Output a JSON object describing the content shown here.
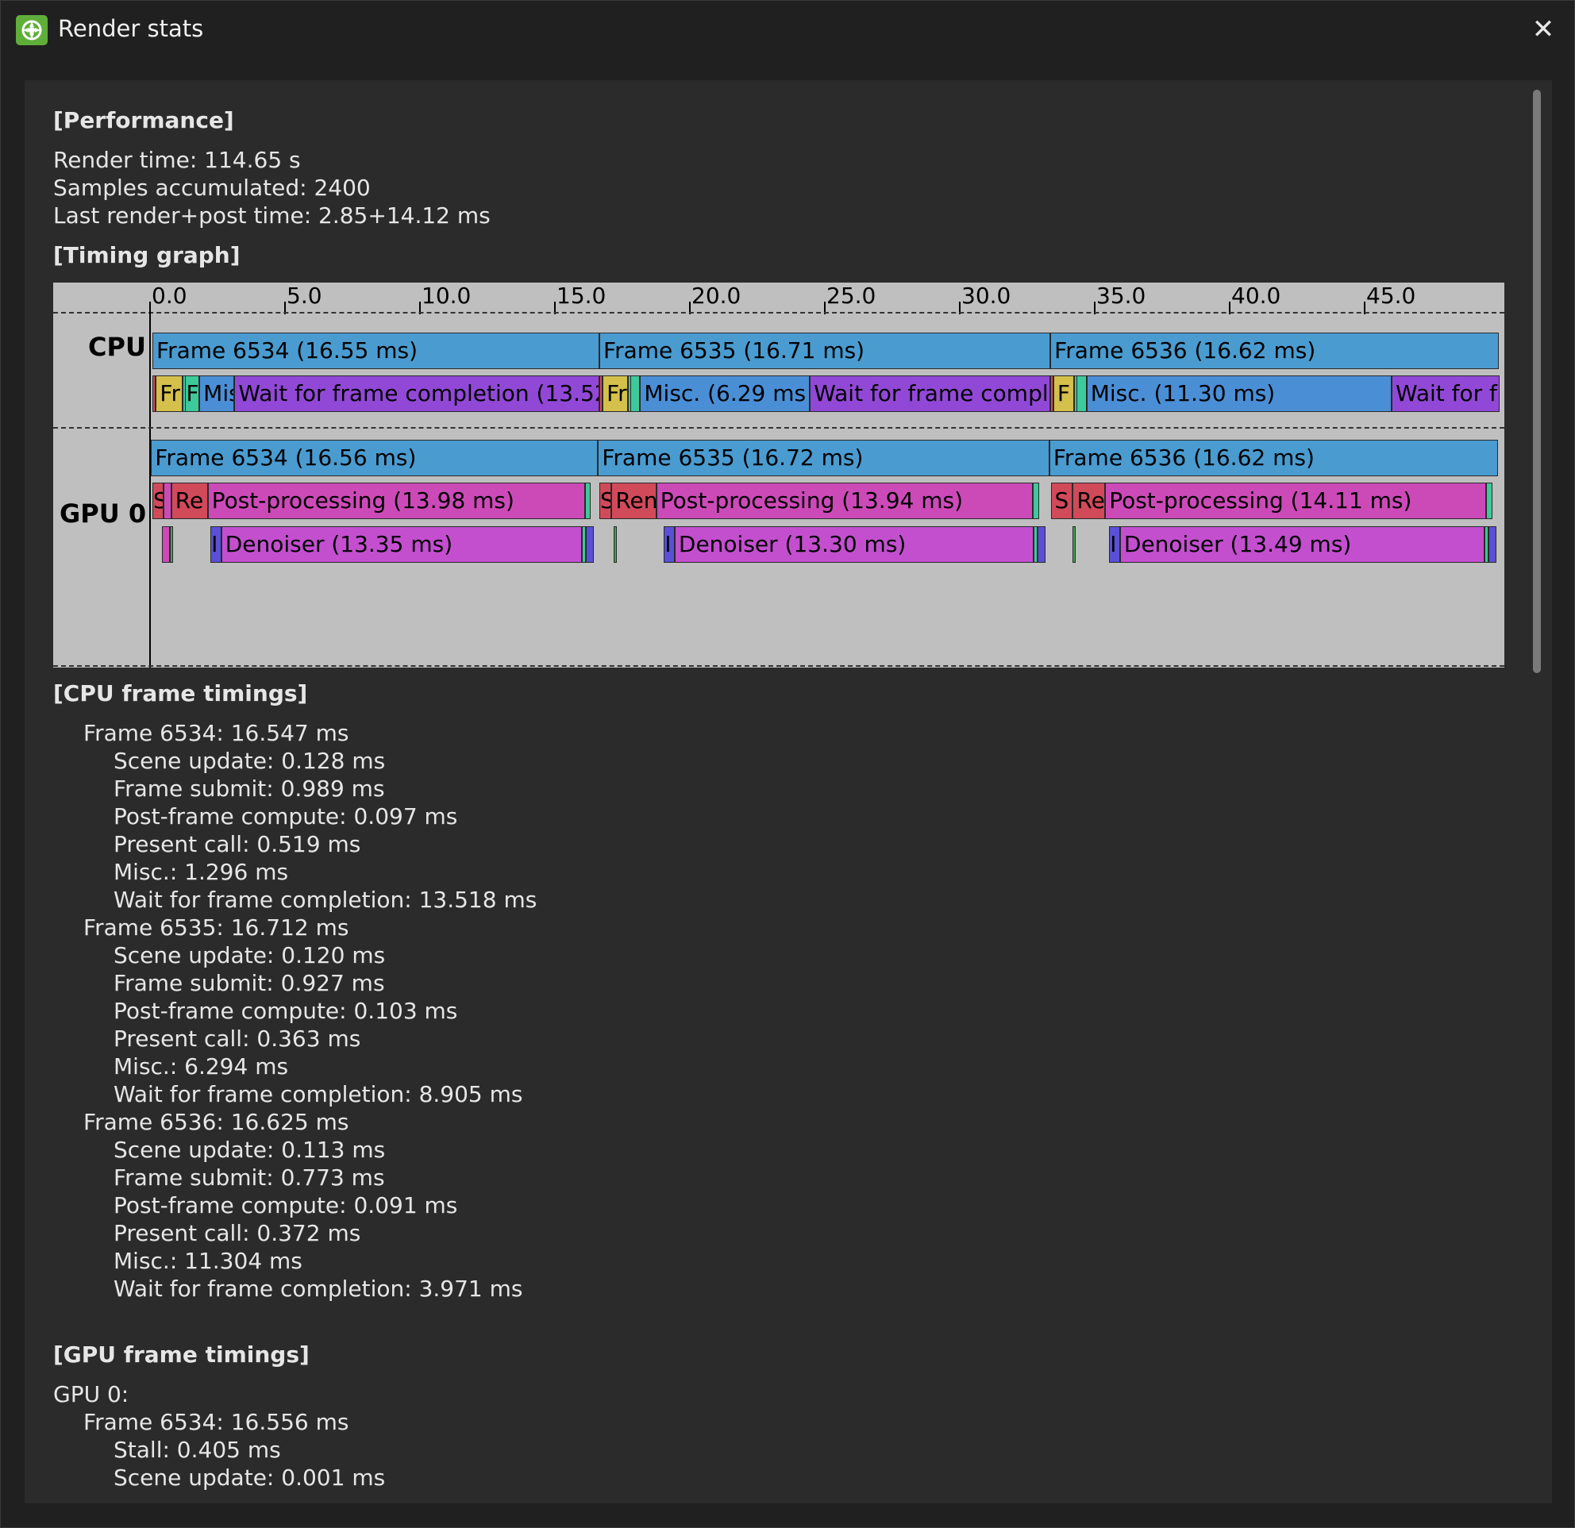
{
  "window": {
    "title": "Render stats",
    "close_glyph": "✕",
    "app_icon": "app-logo-icon"
  },
  "performance": {
    "header": "[Performance]",
    "render_time": "Render time: 114.65 s",
    "samples": "Samples accumulated: 2400",
    "last_time": "Last render+post time: 2.85+14.12 ms"
  },
  "timing_graph": {
    "header": "[Timing graph]",
    "ticks": [
      "0.0",
      "5.0",
      "10.0",
      "15.0",
      "20.0",
      "25.0",
      "30.0",
      "35.0",
      "40.0",
      "45.0"
    ],
    "cpu_label": "CPU",
    "gpu_label": "GPU 0",
    "colors": {
      "frame": "#4a9bd0",
      "yellow": "#d4c04a",
      "teal": "#3ec99a",
      "blue": "#4a8ed6",
      "purple": "#9148d6",
      "red": "#d14a5a",
      "pink": "#cc4ab8",
      "magenta": "#c34fcf",
      "indigo": "#5a4fd6",
      "green": "#3aa84a"
    },
    "cpu_frames": [
      "Frame 6534 (16.55 ms)",
      "Frame 6535 (16.71 ms)",
      "Frame 6536 (16.62 ms)"
    ],
    "cpu_tasks": [
      {
        "t0": 0.0,
        "dur": 0.13,
        "color": "red",
        "text": ""
      },
      {
        "t0": 0.13,
        "dur": 0.99,
        "color": "yellow",
        "text": "Fr"
      },
      {
        "t0": 1.12,
        "dur": 0.1,
        "color": "teal",
        "text": ""
      },
      {
        "t0": 1.22,
        "dur": 0.52,
        "color": "teal",
        "text": "F"
      },
      {
        "t0": 1.74,
        "dur": 1.3,
        "color": "blue",
        "text": "Mis"
      },
      {
        "t0": 3.04,
        "dur": 13.52,
        "color": "purple",
        "text": "Wait for frame completion (13.52"
      },
      {
        "t0": 16.56,
        "dur": 0.12,
        "color": "red",
        "text": ""
      },
      {
        "t0": 16.68,
        "dur": 0.93,
        "color": "yellow",
        "text": "Fr"
      },
      {
        "t0": 17.61,
        "dur": 0.1,
        "color": "teal",
        "text": ""
      },
      {
        "t0": 17.71,
        "dur": 0.36,
        "color": "teal",
        "text": ""
      },
      {
        "t0": 18.07,
        "dur": 6.29,
        "color": "blue",
        "text": "Misc. (6.29 ms"
      },
      {
        "t0": 24.36,
        "dur": 8.91,
        "color": "purple",
        "text": "Wait for frame comple"
      },
      {
        "t0": 33.27,
        "dur": 0.11,
        "color": "red",
        "text": ""
      },
      {
        "t0": 33.38,
        "dur": 0.77,
        "color": "yellow",
        "text": "F"
      },
      {
        "t0": 34.15,
        "dur": 0.09,
        "color": "teal",
        "text": ""
      },
      {
        "t0": 34.24,
        "dur": 0.37,
        "color": "teal",
        "text": ""
      },
      {
        "t0": 34.61,
        "dur": 11.3,
        "color": "blue",
        "text": "Misc. (11.30 ms)"
      },
      {
        "t0": 45.91,
        "dur": 4.0,
        "color": "purple",
        "text": "Wait for f"
      }
    ],
    "gpu_frames": [
      "Frame 6534 (16.56 ms)",
      "Frame 6535 (16.72 ms)",
      "Frame 6536 (16.62 ms)"
    ],
    "gpu_tasks": [
      {
        "t0": 0.0,
        "dur": 0.4,
        "color": "red",
        "text": "S"
      },
      {
        "t0": 0.4,
        "dur": 0.3,
        "color": "pink",
        "text": ""
      },
      {
        "t0": 0.7,
        "dur": 1.35,
        "color": "red",
        "text": "Re"
      },
      {
        "t0": 2.05,
        "dur": 13.98,
        "color": "pink",
        "text": "Post-processing (13.98 ms)"
      },
      {
        "t0": 16.03,
        "dur": 0.2,
        "color": "teal",
        "text": ""
      },
      {
        "t0": 16.56,
        "dur": 0.45,
        "color": "red",
        "text": "S"
      },
      {
        "t0": 17.01,
        "dur": 1.66,
        "color": "red",
        "text": "Ren"
      },
      {
        "t0": 18.67,
        "dur": 13.94,
        "color": "pink",
        "text": "Post-processing (13.94 ms)"
      },
      {
        "t0": 32.61,
        "dur": 0.25,
        "color": "teal",
        "text": ""
      },
      {
        "t0": 33.28,
        "dur": 0.82,
        "color": "red",
        "text": "S"
      },
      {
        "t0": 34.1,
        "dur": 1.2,
        "color": "red",
        "text": "Re"
      },
      {
        "t0": 35.3,
        "dur": 14.11,
        "color": "pink",
        "text": "Post-processing (14.11 ms)"
      },
      {
        "t0": 49.41,
        "dur": 0.25,
        "color": "teal",
        "text": ""
      }
    ],
    "gpu_sub": [
      {
        "t0": 0.35,
        "dur": 0.3,
        "color": "pink",
        "text": ""
      },
      {
        "t0": 0.65,
        "dur": 0.1,
        "color": "green",
        "text": ""
      },
      {
        "t0": 2.15,
        "dur": 0.4,
        "color": "indigo",
        "text": "I"
      },
      {
        "t0": 2.55,
        "dur": 13.35,
        "color": "magenta",
        "text": "Denoiser (13.35 ms)"
      },
      {
        "t0": 15.9,
        "dur": 0.15,
        "color": "teal",
        "text": ""
      },
      {
        "t0": 16.05,
        "dur": 0.3,
        "color": "indigo",
        "text": ""
      },
      {
        "t0": 17.1,
        "dur": 0.1,
        "color": "green",
        "text": ""
      },
      {
        "t0": 18.95,
        "dur": 0.4,
        "color": "indigo",
        "text": "I"
      },
      {
        "t0": 19.35,
        "dur": 13.3,
        "color": "magenta",
        "text": "Denoiser (13.30 ms)"
      },
      {
        "t0": 32.65,
        "dur": 0.15,
        "color": "teal",
        "text": ""
      },
      {
        "t0": 32.8,
        "dur": 0.3,
        "color": "indigo",
        "text": ""
      },
      {
        "t0": 34.1,
        "dur": 0.1,
        "color": "green",
        "text": ""
      },
      {
        "t0": 35.45,
        "dur": 0.4,
        "color": "indigo",
        "text": "I"
      },
      {
        "t0": 35.85,
        "dur": 13.49,
        "color": "magenta",
        "text": "Denoiser (13.49 ms)"
      },
      {
        "t0": 49.34,
        "dur": 0.15,
        "color": "teal",
        "text": ""
      },
      {
        "t0": 49.49,
        "dur": 0.3,
        "color": "indigo",
        "text": ""
      }
    ]
  },
  "cpu_timings": {
    "header": "[CPU frame timings]",
    "lines": [
      {
        "indent": 1,
        "text": "Frame 6534: 16.547 ms"
      },
      {
        "indent": 2,
        "text": "Scene update: 0.128 ms"
      },
      {
        "indent": 2,
        "text": "Frame submit: 0.989 ms"
      },
      {
        "indent": 2,
        "text": "Post-frame compute: 0.097 ms"
      },
      {
        "indent": 2,
        "text": "Present call: 0.519 ms"
      },
      {
        "indent": 2,
        "text": "Misc.: 1.296 ms"
      },
      {
        "indent": 2,
        "text": "Wait for frame completion: 13.518 ms"
      },
      {
        "indent": 1,
        "text": "Frame 6535: 16.712 ms"
      },
      {
        "indent": 2,
        "text": "Scene update: 0.120 ms"
      },
      {
        "indent": 2,
        "text": "Frame submit: 0.927 ms"
      },
      {
        "indent": 2,
        "text": "Post-frame compute: 0.103 ms"
      },
      {
        "indent": 2,
        "text": "Present call: 0.363 ms"
      },
      {
        "indent": 2,
        "text": "Misc.: 6.294 ms"
      },
      {
        "indent": 2,
        "text": "Wait for frame completion: 8.905 ms"
      },
      {
        "indent": 1,
        "text": "Frame 6536: 16.625 ms"
      },
      {
        "indent": 2,
        "text": "Scene update: 0.113 ms"
      },
      {
        "indent": 2,
        "text": "Frame submit: 0.773 ms"
      },
      {
        "indent": 2,
        "text": "Post-frame compute: 0.091 ms"
      },
      {
        "indent": 2,
        "text": "Present call: 0.372 ms"
      },
      {
        "indent": 2,
        "text": "Misc.: 11.304 ms"
      },
      {
        "indent": 2,
        "text": "Wait for frame completion: 3.971 ms"
      }
    ]
  },
  "gpu_timings": {
    "header": "[GPU frame timings]",
    "lines": [
      {
        "indent": 0,
        "text": "GPU 0:"
      },
      {
        "indent": 1,
        "text": "Frame 6534: 16.556 ms"
      },
      {
        "indent": 2,
        "text": "Stall: 0.405 ms"
      },
      {
        "indent": 2,
        "text": "Scene update: 0.001 ms"
      }
    ]
  }
}
